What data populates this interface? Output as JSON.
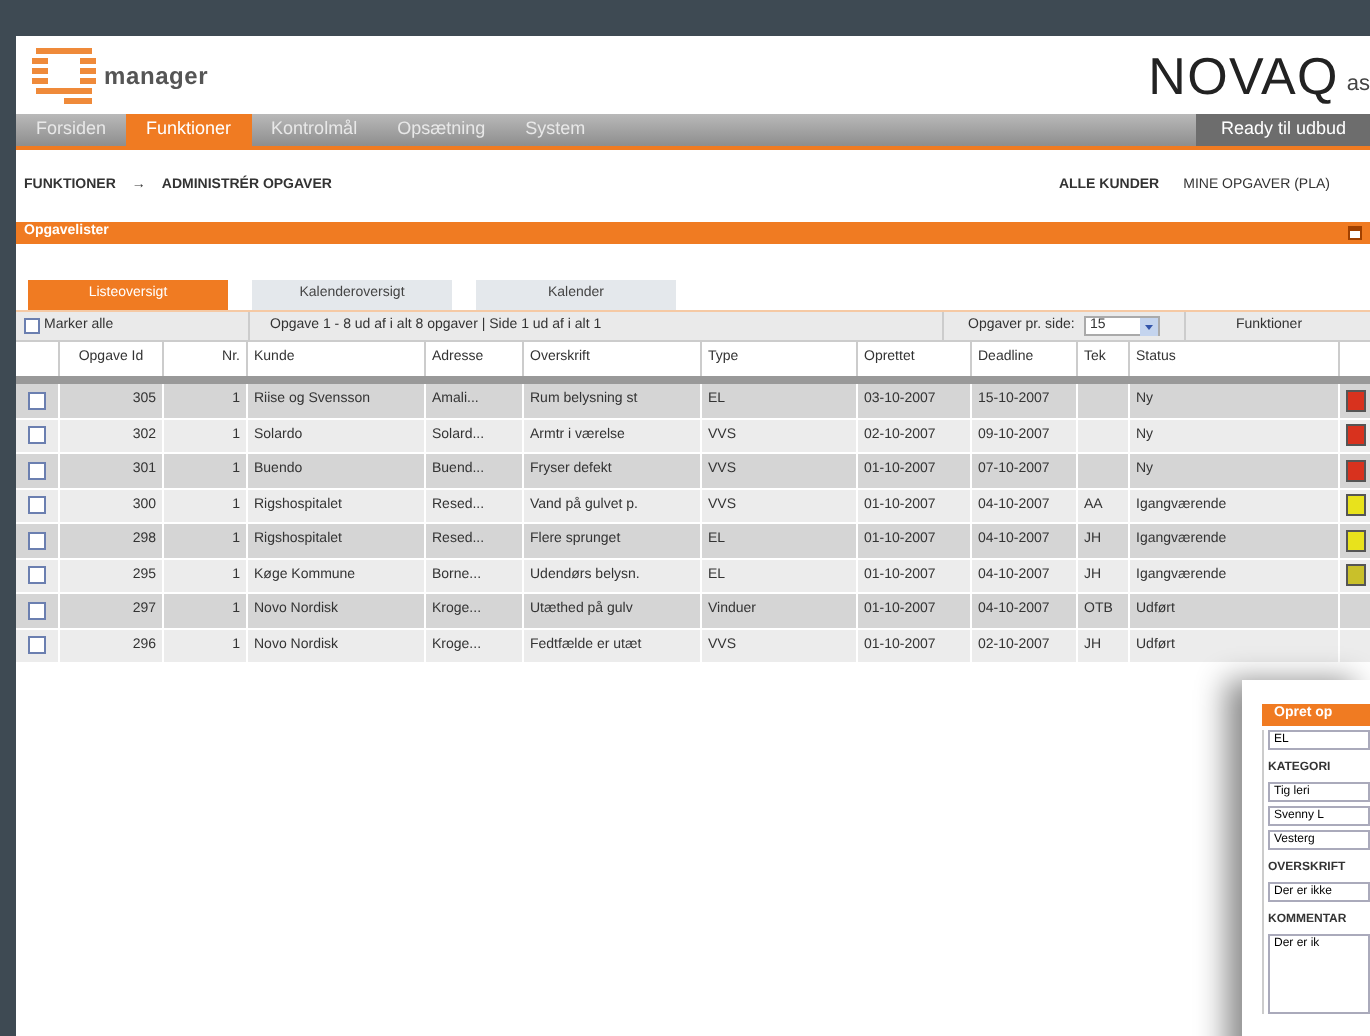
{
  "header": {
    "logo_text": "manager",
    "brand": "NOVAQ",
    "brand_suffix": "as"
  },
  "nav": {
    "items": [
      {
        "label": "Forsiden",
        "selected": false
      },
      {
        "label": "Funktioner",
        "selected": true
      },
      {
        "label": "Kontrolmål",
        "selected": false
      },
      {
        "label": "Opsætning",
        "selected": false
      },
      {
        "label": "System",
        "selected": false
      }
    ],
    "right_button": "Ready til udbud"
  },
  "breadcrumb": {
    "parent": "FUNKTIONER",
    "arrow": "→",
    "current": "ADMINISTRÉR OPGAVER",
    "filters": [
      "ALLE KUNDER",
      "MINE OPGAVER (PLA)"
    ]
  },
  "panel": {
    "title": "Opgavelister"
  },
  "tabs": [
    {
      "label": "Listeoversigt",
      "selected": true
    },
    {
      "label": "Kalenderoversigt",
      "selected": false
    },
    {
      "label": "Kalender",
      "selected": false
    }
  ],
  "toolbar": {
    "select_all": {
      "label": "Marker alle",
      "checked": false
    },
    "paging": "Opgave 1 - 8 ud af i alt 8 opgaver | Side 1 ud af i alt 1",
    "per_page_label": "Opgaver pr. side:",
    "per_page": "15",
    "functions": "Funktioner"
  },
  "table": {
    "columns": [
      "Opgave Id",
      "Nr.",
      "Kunde",
      "Adresse",
      "Overskrift",
      "Type",
      "Oprettet",
      "Deadline",
      "Tek",
      "Status"
    ],
    "rows": [
      {
        "checked": false,
        "cells": [
          "305",
          "1",
          "Riise og Svensson",
          "Amali...",
          "Rum belysning st",
          "EL",
          "03-10-2007",
          "15-10-2007",
          "",
          "Ny"
        ],
        "color": "#d8321e"
      },
      {
        "checked": false,
        "cells": [
          "302",
          "1",
          "Solardo",
          "Solard...",
          "Armtr i værelse",
          "VVS",
          "02-10-2007",
          "09-10-2007",
          "",
          "Ny"
        ],
        "color": "#d8321e"
      },
      {
        "checked": false,
        "cells": [
          "301",
          "1",
          "Buendo",
          "Buend...",
          "Fryser defekt",
          "VVS",
          "01-10-2007",
          "07-10-2007",
          "",
          "Ny"
        ],
        "color": "#d8321e"
      },
      {
        "checked": false,
        "cells": [
          "300",
          "1",
          "Rigshospitalet",
          "Resed...",
          "Vand på gulvet p.",
          "VVS",
          "01-10-2007",
          "04-10-2007",
          "AA",
          "Igangværende"
        ],
        "color": "#e8e21c"
      },
      {
        "checked": false,
        "cells": [
          "298",
          "1",
          "Rigshospitalet",
          "Resed...",
          "Flere sprunget",
          "EL",
          "01-10-2007",
          "04-10-2007",
          "JH",
          "Igangværende"
        ],
        "color": "#e8e21c"
      },
      {
        "checked": false,
        "cells": [
          "295",
          "1",
          "Køge Kommune",
          "Borne...",
          "Udendørs belysn.",
          "EL",
          "01-10-2007",
          "04-10-2007",
          "JH",
          "Igangværende"
        ],
        "color": "#c9c02a"
      },
      {
        "checked": false,
        "cells": [
          "297",
          "1",
          "Novo Nordisk",
          "Kroge...",
          "Utæthed på gulv",
          "Vinduer",
          "01-10-2007",
          "04-10-2007",
          "OTB",
          "Udført"
        ]
      },
      {
        "checked": false,
        "cells": [
          "296",
          "1",
          "Novo Nordisk",
          "Kroge...",
          "Fedtfælde er utæt",
          "VVS",
          "01-10-2007",
          "02-10-2007",
          "JH",
          "Udført"
        ]
      }
    ]
  },
  "dialog": {
    "title": "Opret op",
    "fields": [
      {
        "kind": "input",
        "value": "EL"
      },
      {
        "kind": "label",
        "value": "KATEGORI"
      },
      {
        "kind": "input",
        "value": "Tig leri"
      },
      {
        "kind": "input",
        "value": "Svenny L"
      },
      {
        "kind": "input",
        "value": "Vesterg"
      },
      {
        "kind": "label",
        "value": "OVERSKRIFT"
      },
      {
        "kind": "input",
        "value": "Der er ikke"
      },
      {
        "kind": "label",
        "value": "KOMMENTAR"
      },
      {
        "kind": "textarea",
        "value": "Der er ik"
      }
    ]
  }
}
